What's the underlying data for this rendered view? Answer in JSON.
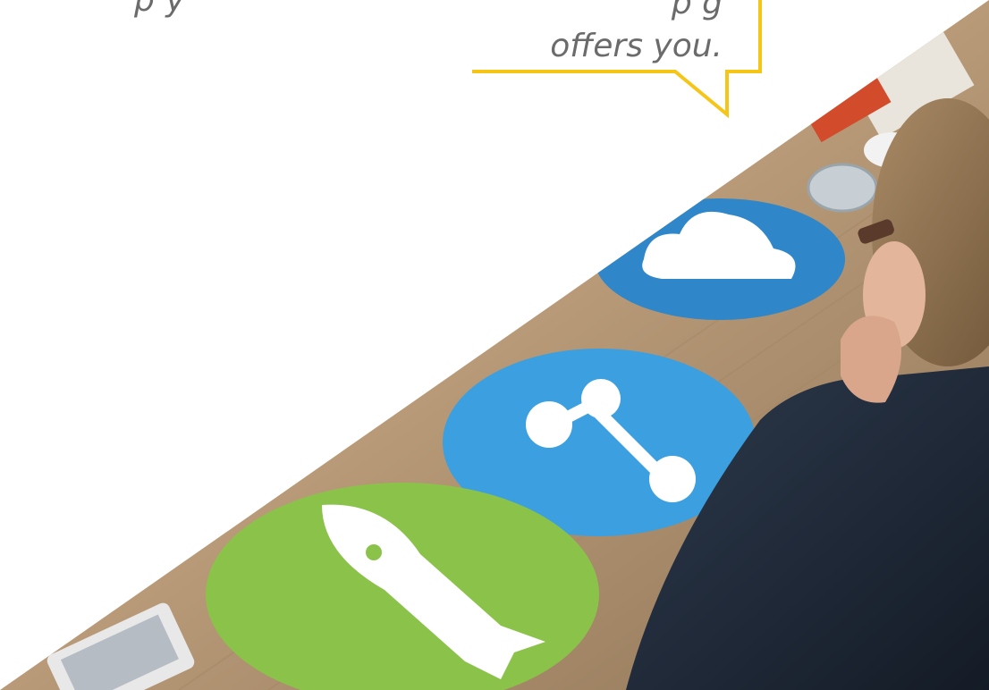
{
  "quote": {
    "line_left_fragment": "p y",
    "line_right_fragment": "p g",
    "last_line": "offers you."
  },
  "colors": {
    "accent_yellow": "#f5c518",
    "text_gray": "#6b6b6b",
    "disc_blue": "#3b9fe0",
    "disc_blue_dark": "#2f86c8",
    "disc_green": "#8bc34a",
    "table_wood": "#b89a78"
  },
  "icons": [
    "cloud-icon",
    "share-icon",
    "rocket-icon"
  ]
}
